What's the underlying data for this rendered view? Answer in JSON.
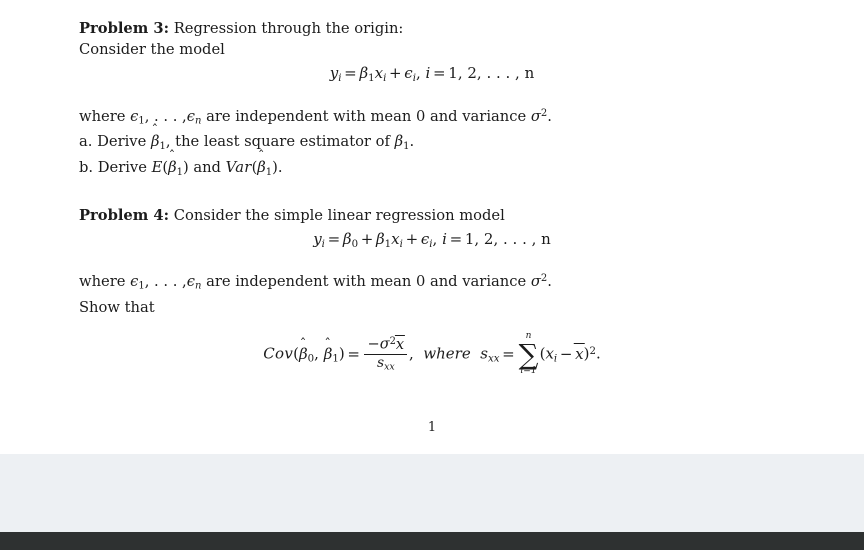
{
  "document": {
    "page_number": "1",
    "problems": [
      {
        "id": "problem-3",
        "label": "Problem 3:",
        "title": "Regression through the origin:",
        "intro": "Consider the model",
        "equation": {
          "lhs_var": "y",
          "lhs_sub": "i",
          "equals": "=",
          "beta1": "β",
          "beta1_sub": "1",
          "x_var": "x",
          "x_sub": "i",
          "plus": "+",
          "eps": "ϵ",
          "eps_sub": "i",
          "comma": ",",
          "index_var": "i",
          "index_equals": "=",
          "index_values": "1, 2, . . . , n"
        },
        "assumption_prefix": "where",
        "assumption_eps1": "ϵ",
        "assumption_eps1_sub": "1",
        "assumption_dots": ", . . . ,",
        "assumption_epsn": "ϵ",
        "assumption_epsn_sub": "n",
        "assumption_text": "are independent with mean 0 and variance",
        "assumption_sigma": "σ",
        "assumption_sigma_sup": "2",
        "assumption_period": ".",
        "parts": [
          {
            "marker": "a.",
            "text_before": "Derive",
            "symbol": "β",
            "symbol_hat": "ˆ",
            "symbol_sub": "1",
            "text_middle": ", the least square estimator of",
            "symbol2": "β",
            "symbol2_sub": "1",
            "text_after": "."
          },
          {
            "marker": "b.",
            "text_before": "Derive",
            "func1": "E",
            "symbol": "β",
            "symbol_hat": "ˆ",
            "symbol_sub": "1",
            "text_middle": "and",
            "func2": "Var",
            "symbol2": "β",
            "symbol2_sub": "1",
            "text_after": "."
          }
        ]
      },
      {
        "id": "problem-4",
        "label": "Problem 4:",
        "title": "Consider the simple linear regression model",
        "equation": {
          "lhs_var": "y",
          "lhs_sub": "i",
          "equals": "=",
          "beta0": "β",
          "beta0_sub": "0",
          "plus1": "+",
          "beta1": "β",
          "beta1_sub": "1",
          "x_var": "x",
          "x_sub": "i",
          "plus2": "+",
          "eps": "ϵ",
          "eps_sub": "i",
          "comma": ",",
          "index_var": "i",
          "index_equals": "=",
          "index_values": "1, 2, . . . , n"
        },
        "assumption_prefix": "where",
        "assumption_eps1": "ϵ",
        "assumption_eps1_sub": "1",
        "assumption_dots": ", . . . ,",
        "assumption_epsn": "ϵ",
        "assumption_epsn_sub": "n",
        "assumption_text": "are independent with mean 0 and variance",
        "assumption_sigma": "σ",
        "assumption_sigma_sup": "2",
        "assumption_period": ".",
        "show_that": "Show that",
        "result": {
          "cov_name": "Cov",
          "open_paren": "(",
          "beta0": "β",
          "beta0_hat": "ˆ",
          "beta0_sub": "0",
          "arg_comma": ",",
          "beta1": "β",
          "beta1_hat": "ˆ",
          "beta1_sub": "1",
          "close_paren": ")",
          "equals": "=",
          "numerator_minus": "−",
          "numerator_sigma": "σ",
          "numerator_sigma_sup": "2",
          "numerator_xbar": "x",
          "denominator_s": "s",
          "denominator_sub": "xx",
          "trailing_comma": ",",
          "where_word": "where",
          "sxx_s": "s",
          "sxx_sub": "xx",
          "sxx_equals": "=",
          "sum_glyph": "∑",
          "sum_upper": "n",
          "sum_lower": "i=1",
          "term_open": "(",
          "term_x": "x",
          "term_x_sub": "i",
          "term_minus": "−",
          "term_xbar": "x",
          "term_close": ")",
          "term_sup": "2",
          "final_period": "."
        }
      }
    ]
  },
  "viewer": {
    "page_background": "#ffffff",
    "viewer_background": "#edf0f3",
    "bottom_bar_color": "#2e3131",
    "text_color": "#1c1c1c"
  }
}
